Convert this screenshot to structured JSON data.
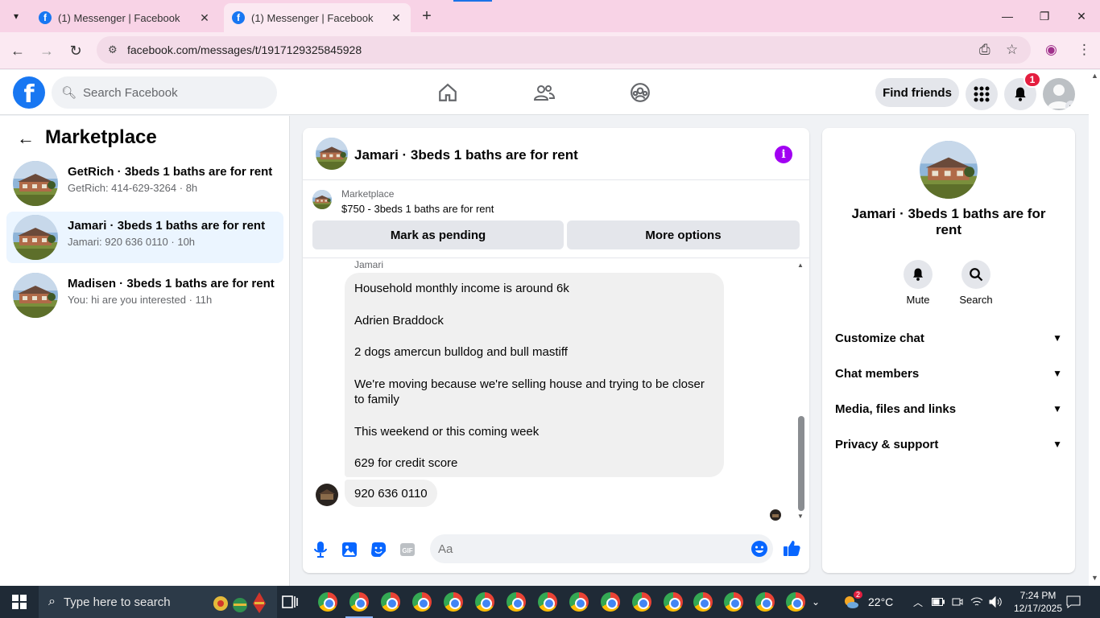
{
  "browser": {
    "tabs": [
      {
        "title": "(1) Messenger | Facebook"
      },
      {
        "title": "(1) Messenger | Facebook"
      }
    ],
    "url": "facebook.com/messages/t/1917129325845928"
  },
  "header": {
    "search_placeholder": "Search Facebook",
    "find_friends": "Find friends",
    "notification_count": "1"
  },
  "sidebar": {
    "title": "Marketplace",
    "conversations": [
      {
        "name": "GetRich · 3beds 1 baths are for rent",
        "preview": "GetRich: 414-629-3264 · 8h",
        "selected": false
      },
      {
        "name": "Jamari · 3beds 1 baths are for rent",
        "preview": "Jamari: 920 636 0110 · 10h",
        "selected": true
      },
      {
        "name": "Madisen · 3beds 1 baths are for rent",
        "preview": "You: hi are you interested · 11h",
        "selected": false
      }
    ]
  },
  "chat": {
    "title": "Jamari · 3beds 1 baths are for rent",
    "marketplace_label": "Marketplace",
    "listing": "$750 - 3beds 1 baths are for rent",
    "mark_pending": "Mark as pending",
    "more_options": "More options",
    "sender": "Jamari",
    "message_lines": [
      "Household monthly income is around 6k",
      "Adrien Braddock",
      "2 dogs amercun bulldog and bull mastiff",
      "We're moving because we're selling house and trying to be closer to family",
      "This weekend or this coming week",
      "629 for credit score"
    ],
    "last_message": "920 636 0110",
    "input_placeholder": "Aa"
  },
  "details": {
    "name": "Jamari · 3beds 1 baths are for rent",
    "actions": [
      {
        "label": "Mute"
      },
      {
        "label": "Search"
      }
    ],
    "sections": [
      "Customize chat",
      "Chat members",
      "Media, files and links",
      "Privacy & support"
    ]
  },
  "taskbar": {
    "search_placeholder": "Type here to search",
    "weather": "22°C",
    "weather_badge": "2",
    "time": "7:24 PM",
    "date": "12/17/2025"
  },
  "colors": {
    "fb_blue": "#1877f2",
    "messenger_blue": "#0866ff",
    "info_purple": "#a100f2",
    "selected_bg": "#ebf5ff",
    "badge_red": "#e41e3f"
  }
}
